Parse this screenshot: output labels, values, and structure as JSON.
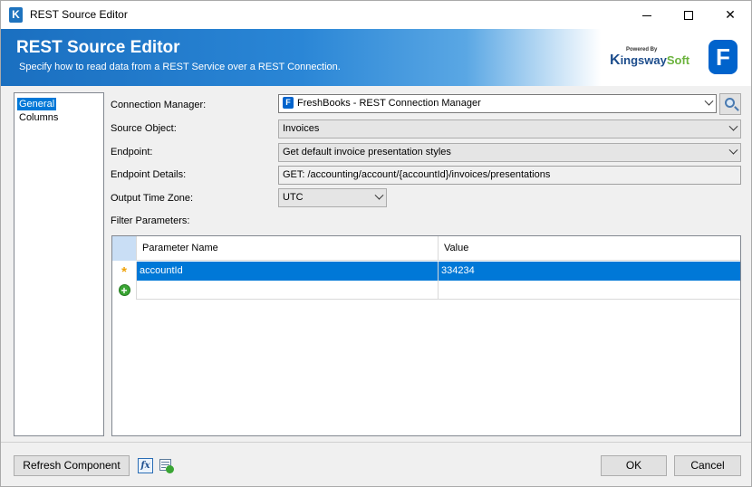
{
  "window": {
    "title": "REST Source Editor",
    "controls": {
      "minimize": "minimize",
      "maximize": "maximize",
      "close": "✕"
    }
  },
  "banner": {
    "title": "REST Source Editor",
    "subtitle": "Specify how to read data from a REST Service over a REST Connection.",
    "logo_powered": "Powered By",
    "logo_name_k": "K",
    "logo_name_mid": "ingsway",
    "logo_name_end": "Soft",
    "app_logo": "F"
  },
  "nav": {
    "items": [
      {
        "label": "General",
        "selected": true
      },
      {
        "label": "Columns",
        "selected": false
      }
    ]
  },
  "form": {
    "connection_manager": {
      "label": "Connection Manager:",
      "value": "FreshBooks - REST Connection Manager"
    },
    "source_object": {
      "label": "Source Object:",
      "value": "Invoices"
    },
    "endpoint": {
      "label": "Endpoint:",
      "value": "Get default invoice presentation styles"
    },
    "endpoint_details": {
      "label": "Endpoint Details:",
      "value": "GET: /accounting/account/{accountId}/invoices/presentations"
    },
    "output_time_zone": {
      "label": "Output Time Zone:",
      "value": "UTC"
    },
    "filter_parameters": {
      "label": "Filter Parameters:"
    }
  },
  "grid": {
    "columns": [
      "Parameter Name",
      "Value"
    ],
    "rows": [
      {
        "name": "accountId",
        "value": "334234",
        "selected": true
      }
    ]
  },
  "footer": {
    "refresh_label": "Refresh Component",
    "fx_label": "fx",
    "ok_label": "OK",
    "cancel_label": "Cancel"
  },
  "colors": {
    "selection": "#0078d7",
    "banner_blue": "#1a6fc0",
    "brand_freshbooks": "#0063cc"
  },
  "icons": {
    "app": "kingswaysoft-k-icon",
    "search": "magnifier-icon",
    "new_row": "asterisk-icon",
    "add_row": "plus-circle-icon",
    "expression": "fx-icon",
    "columns": "grid-check-icon"
  }
}
